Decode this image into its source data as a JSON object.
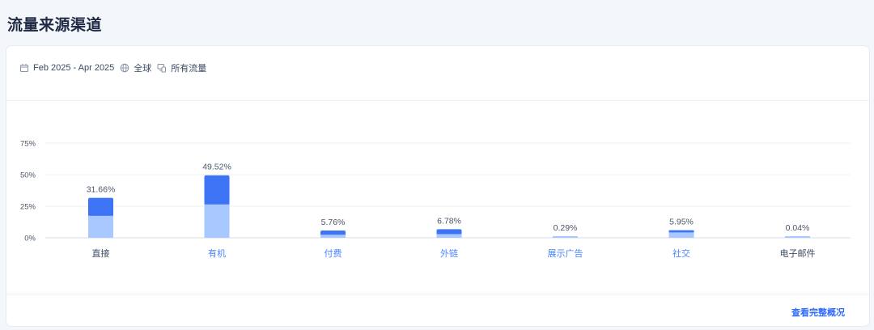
{
  "title": "流量来源渠道",
  "filters": {
    "date_range": "Feb 2025 - Apr 2025",
    "region": "全球",
    "traffic_type": "所有流量"
  },
  "footer": {
    "link_label": "查看完整概况"
  },
  "colors": {
    "bar_top": "#3d74f5",
    "bar_bottom": "#a9c8ff",
    "category_active": "#4a86ff",
    "category_default": "#3b4a63"
  },
  "chart_data": {
    "type": "bar",
    "stacked": true,
    "categories": [
      "直接",
      "有机",
      "付费",
      "外链",
      "展示广告",
      "社交",
      "电子邮件"
    ],
    "category_linked": [
      false,
      true,
      true,
      true,
      true,
      true,
      false
    ],
    "values": [
      31.66,
      49.52,
      5.76,
      6.78,
      0.29,
      5.95,
      0.04
    ],
    "data_labels": [
      "31.66%",
      "49.52%",
      "5.76%",
      "6.78%",
      "0.29%",
      "5.95%",
      "0.04%"
    ],
    "series": [
      {
        "values": [
          17.5,
          26.5,
          2.5,
          3.0,
          0.29,
          4.3,
          0.04
        ]
      },
      {
        "values": [
          14.16,
          23.02,
          3.26,
          3.78,
          0.0,
          1.65,
          0.0
        ]
      }
    ],
    "y_ticks": [
      "0%",
      "25%",
      "50%",
      "75%"
    ],
    "y_tick_values": [
      0,
      25,
      50,
      75
    ],
    "ylim": [
      0,
      75
    ],
    "grid": true,
    "legend": "none"
  }
}
